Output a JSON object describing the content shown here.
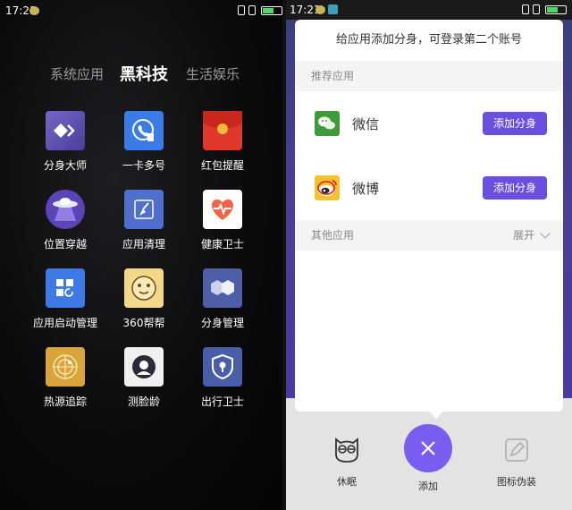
{
  "left": {
    "status": {
      "time": "17:21"
    },
    "tabs": [
      {
        "label": "系统应用"
      },
      {
        "label": "黑科技"
      },
      {
        "label": "生活娱乐"
      }
    ],
    "apps": [
      {
        "label": "分身大师",
        "icon": "clone-master-icon"
      },
      {
        "label": "一卡多号",
        "icon": "multi-number-icon"
      },
      {
        "label": "红包提醒",
        "icon": "red-envelope-icon"
      },
      {
        "label": "位置穿越",
        "icon": "location-ufo-icon"
      },
      {
        "label": "应用清理",
        "icon": "broom-icon"
      },
      {
        "label": "健康卫士",
        "icon": "health-heart-icon"
      },
      {
        "label": "应用启动管理",
        "icon": "app-launch-icon"
      },
      {
        "label": "360帮帮",
        "icon": "360-help-icon"
      },
      {
        "label": "分身管理",
        "icon": "clone-manage-icon"
      },
      {
        "label": "热源追踪",
        "icon": "radar-icon"
      },
      {
        "label": "测脸龄",
        "icon": "face-age-icon"
      },
      {
        "label": "出行卫士",
        "icon": "shield-icon"
      }
    ]
  },
  "right": {
    "status": {
      "time": "17:21"
    },
    "card": {
      "title": "给应用添加分身，可登录第二个账号",
      "recommended_label": "推荐应用",
      "apps": [
        {
          "name": "微信",
          "button": "添加分身",
          "icon": "wechat-icon"
        },
        {
          "name": "微博",
          "button": "添加分身",
          "icon": "weibo-icon"
        }
      ],
      "other_label": "其他应用",
      "expand_label": "展开"
    },
    "dock": {
      "sleep_label": "休眠",
      "add_label": "添加",
      "disguise_label": "图标伪装"
    }
  },
  "colors": {
    "accent": "#6b4fe0",
    "fab": "#7b5cf0"
  }
}
